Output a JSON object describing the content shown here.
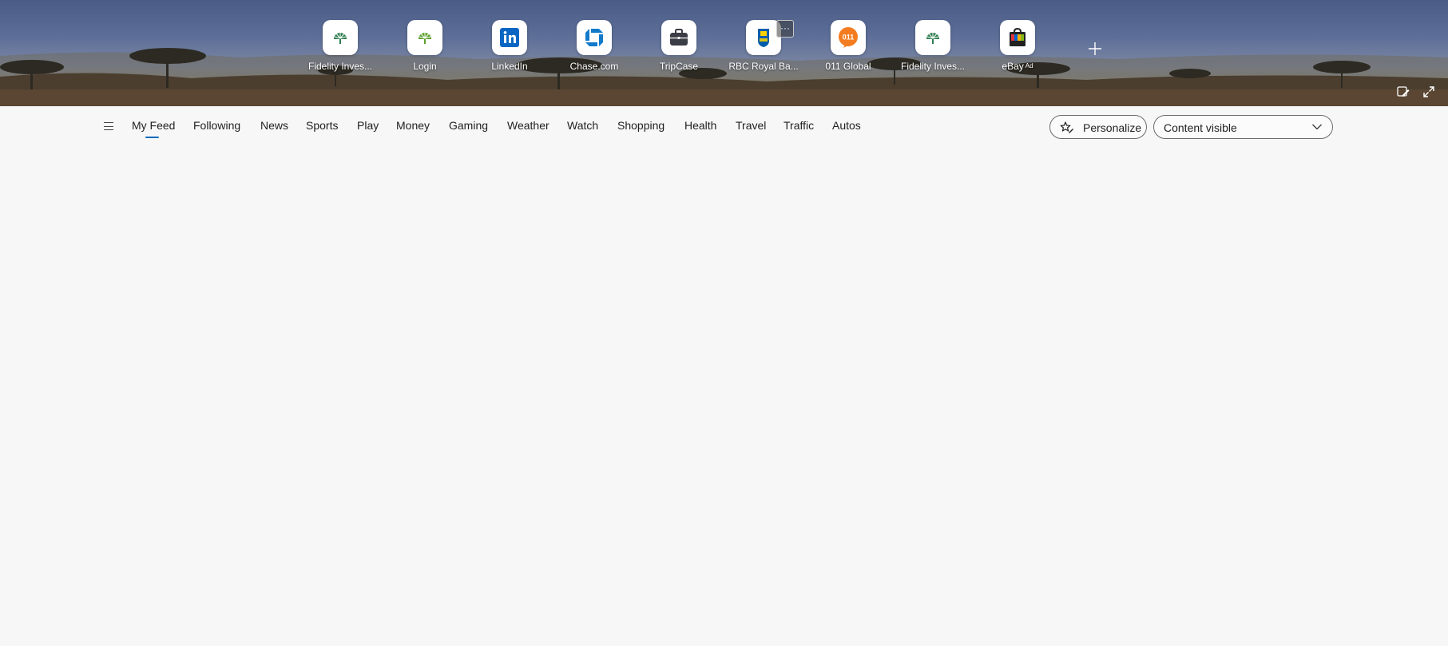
{
  "shortcuts": [
    {
      "label": "Fidelity Inves...",
      "icon": "fidelity-icon"
    },
    {
      "label": "Login",
      "icon": "fidelity-icon"
    },
    {
      "label": "LinkedIn",
      "icon": "linkedin-icon"
    },
    {
      "label": "Chase.com",
      "icon": "chase-icon"
    },
    {
      "label": "TripCase",
      "icon": "briefcase-icon"
    },
    {
      "label": "RBC Royal Ba...",
      "icon": "rbc-icon"
    },
    {
      "label": "011 Global",
      "icon": "global-011-icon"
    },
    {
      "label": "Fidelity Inves...",
      "icon": "fidelity-icon"
    },
    {
      "label": "eBay",
      "ad_badge": "Ad",
      "icon": "ebay-icon"
    }
  ],
  "shortcut_more_label": "···",
  "nav": {
    "items": [
      "My Feed",
      "Following",
      "News",
      "Sports",
      "Play",
      "Money",
      "Gaming",
      "Weather",
      "Watch",
      "Shopping",
      "Health",
      "Travel",
      "Traffic",
      "Autos"
    ],
    "active": "My Feed"
  },
  "personalize_label": "Personalize",
  "content_select": {
    "value": "Content visible"
  },
  "colors": {
    "accent": "#0f6cbd",
    "fidelity_green": "#2e7d4f",
    "linkedin_blue": "#0a66c2",
    "chase_blue": "#117aca",
    "rbc_blue": "#005daa",
    "rbc_yellow": "#ffd200",
    "global_011_orange": "#f47c20",
    "tripcase_gray": "#3a3d45"
  }
}
